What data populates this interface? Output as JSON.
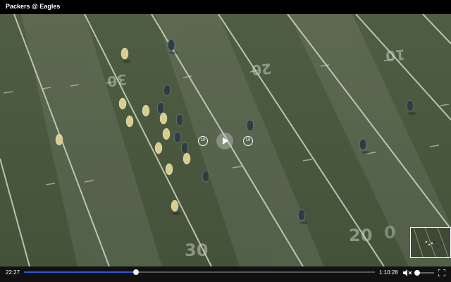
{
  "window": {
    "title": "Packers @ Eagles"
  },
  "field": {
    "yard_numbers_far": [
      "30",
      "20",
      "10"
    ],
    "yard_numbers_near": [
      "30",
      "20"
    ],
    "grass_color": "#4a5a3c",
    "line_color": "#cfd6c8"
  },
  "players": {
    "home_color": "#2e3d42",
    "away_color": "#d8cf8e"
  },
  "overlay": {
    "skip_back_label": "10",
    "skip_forward_label": "10",
    "play_icon": "play-icon"
  },
  "controls": {
    "current_time": "22:27",
    "total_time": "1:10:28",
    "progress": 0.32,
    "volume": 0.15,
    "accent_color": "#2a5bd7",
    "mute_icon": "volume-muted-icon",
    "fullscreen_icon": "fullscreen-icon"
  }
}
